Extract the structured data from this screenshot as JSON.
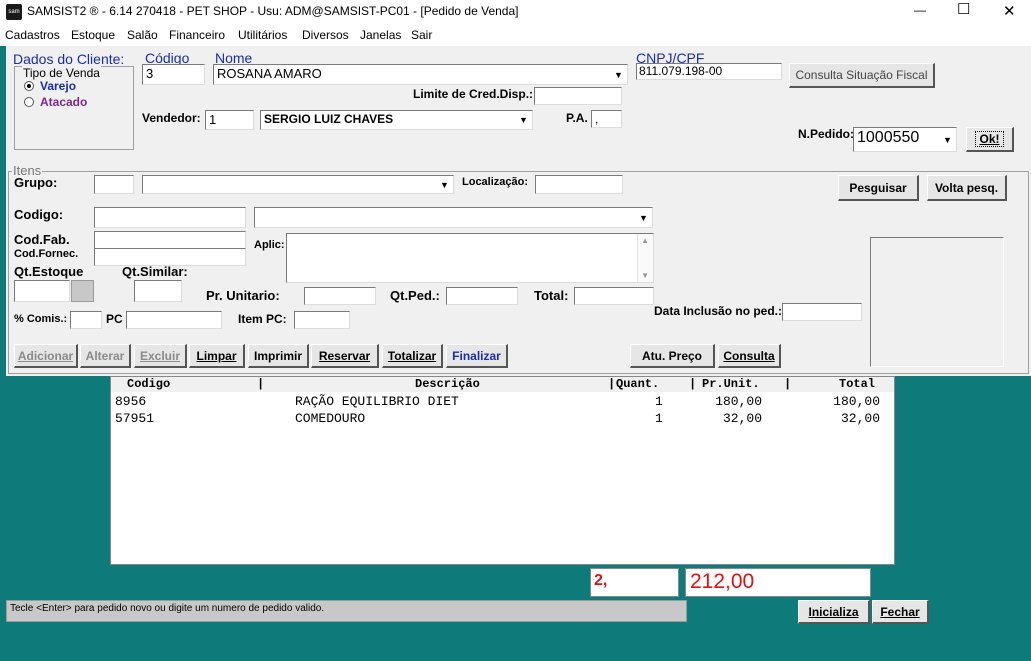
{
  "window": {
    "title": "SAMSIST2 ® - 6.14 270418 - PET SHOP - Usu: ADM@SAMSIST-PC01 - [Pedido de Venda]",
    "app_icon_text": "sam",
    "minimize": "—",
    "maximize": "☐",
    "close": "✕"
  },
  "menu": [
    "Cadastros",
    "Estoque",
    "Salão",
    "Financeiro",
    "Utilitários",
    "Diversos",
    "Janelas",
    "Sair"
  ],
  "cliente": {
    "section_label": "Dados do Cliente:",
    "tipo_venda_label": "Tipo de Venda",
    "varejo": "Varejo",
    "atacado": "Atacado",
    "codigo_label": "Código",
    "codigo": "3",
    "nome_label": "Nome",
    "nome": "ROSANA AMARO",
    "cnpj_label": "CNPJ/CPF",
    "cnpj": "811.079.198-00",
    "consulta_fiscal": "Consulta Situação Fiscal",
    "limite_label": "Limite de Cred.Disp.:",
    "limite": "",
    "vendedor_label": "Vendedor:",
    "vendedor_codigo": "1",
    "vendedor_nome": "SERGIO LUIZ CHAVES",
    "pa_label": "P.A.",
    "pa": ",",
    "npedido_label": "N.Pedido:",
    "npedido": "1000550",
    "ok": "Ok!"
  },
  "itens": {
    "section_label": "Itens",
    "grupo_label": "Grupo:",
    "localizacao_label": "Localização:",
    "pesquisar": "Pesguisar",
    "volta_pesq": "Volta pesq.",
    "codigo_label": "Codigo:",
    "codfab_label": "Cod.Fab.",
    "codfornec_label": "Cod.Fornec.",
    "aplic_label": "Aplic:",
    "qtestoque_label": "Qt.Estoque",
    "qtsimilar_label": "Qt.Similar:",
    "prunitario_label": "Pr. Unitario:",
    "qtped_label": "Qt.Ped.:",
    "total_label": "Total:",
    "comis_label": "% Comis.:",
    "pc_label": "PC",
    "itempc_label": "Item PC:",
    "data_inclusao_label": "Data Inclusão no ped.:"
  },
  "actions": {
    "adicionar": "Adicionar",
    "alterar": "Alterar",
    "excluir": "Excluir",
    "limpar": "Limpar",
    "imprimir": "Imprimir",
    "reservar": "Reservar",
    "totalizar": "Totalizar",
    "finalizar": "Finalizar",
    "atu_preco": "Atu. Preço",
    "consulta": "Consulta"
  },
  "grid": {
    "headers": {
      "codigo": "Codigo",
      "descricao": "Descrição",
      "quant": "Quant.",
      "prunit": "Pr.Unit.",
      "total": "Total"
    },
    "rows": [
      {
        "codigo": "8956",
        "descricao": "RAÇÃO EQUILIBRIO DIET",
        "quant": "1",
        "prunit": "180,00",
        "total": "180,00"
      },
      {
        "codigo": "57951",
        "descricao": "COMEDOURO",
        "quant": "1",
        "prunit": "32,00",
        "total": "32,00"
      }
    ]
  },
  "totals": {
    "count": "2,",
    "amount": "212,00"
  },
  "status": "Tecle <Enter> para pedido novo ou digite um numero de pedido valido.",
  "footer": {
    "inicializa": "Inicializa",
    "fechar": "Fechar"
  },
  "colors": {
    "background": "#0e7a7a",
    "accent_red": "#e01010",
    "label_blue": "#1b2ea8"
  }
}
